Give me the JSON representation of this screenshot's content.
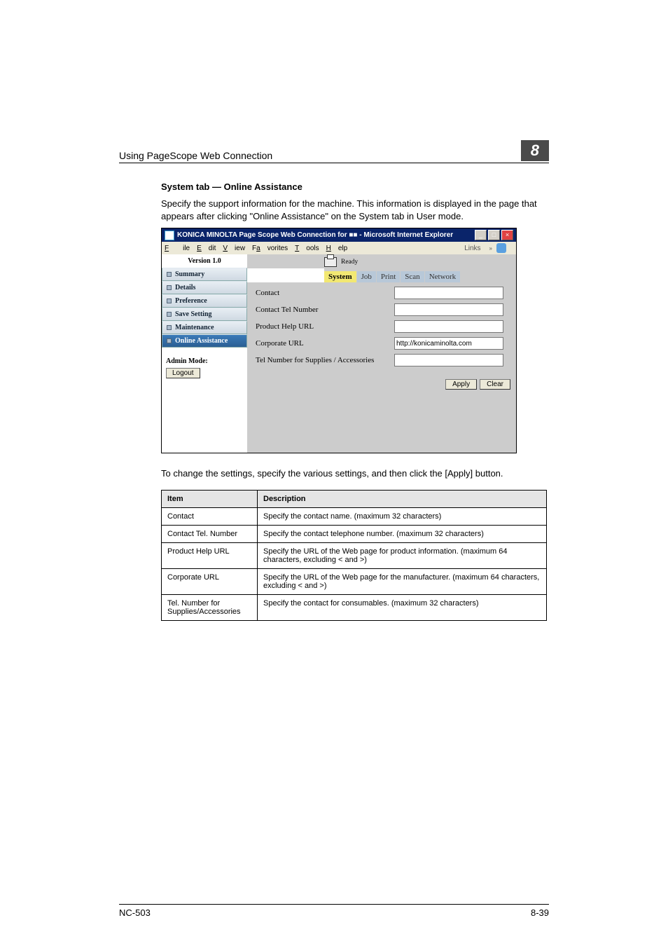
{
  "page": {
    "section_title": "Using PageScope Web Connection",
    "chapter_number": "8",
    "sub_heading": "System tab — Online Assistance",
    "intro_text": "Specify the support information for the machine. This information is displayed in the page that appears after clicking \"Online Assistance\" on the System tab in User mode.",
    "below_text": "To change the settings, specify the various settings, and then click the [Apply] button.",
    "footer_left": "NC-503",
    "footer_right": "8-39"
  },
  "screenshot": {
    "title_bar": "KONICA MINOLTA Page Scope Web Connection for ■■ - Microsoft Internet Explorer",
    "menu": {
      "file": "File",
      "edit": "Edit",
      "view": "View",
      "favorites": "Favorites",
      "tools": "Tools",
      "help": "Help",
      "links": "Links"
    },
    "status_text": "Ready",
    "version": "Version 1.0",
    "tabs": {
      "system": "System",
      "job": "Job",
      "print": "Print",
      "scan": "Scan",
      "network": "Network"
    },
    "sidebar": {
      "items": [
        {
          "label": "Summary"
        },
        {
          "label": "Details"
        },
        {
          "label": "Preference"
        },
        {
          "label": "Save Setting"
        },
        {
          "label": "Maintenance"
        },
        {
          "label": "Online Assistance"
        }
      ],
      "admin_mode_label": "Admin Mode:",
      "logout_label": "Logout"
    },
    "form": {
      "contact_label": "Contact",
      "contact_value": "",
      "contact_tel_label": "Contact Tel Number",
      "contact_tel_value": "",
      "product_help_label": "Product Help URL",
      "product_help_value": "",
      "corporate_url_label": "Corporate URL",
      "corporate_url_value": "http://konicaminolta.com",
      "supplies_label": "Tel Number for Supplies / Accessories",
      "supplies_value": "",
      "apply": "Apply",
      "clear": "Clear"
    }
  },
  "table": {
    "header_item": "Item",
    "header_desc": "Description",
    "rows": [
      {
        "item": "Contact",
        "desc": "Specify the contact name. (maximum 32 characters)"
      },
      {
        "item": "Contact Tel. Number",
        "desc": "Specify the contact telephone number. (maximum 32 characters)"
      },
      {
        "item": "Product Help URL",
        "desc": "Specify the URL of the Web page for product information. (maximum 64 characters, excluding < and >)"
      },
      {
        "item": "Corporate URL",
        "desc": "Specify the URL of the Web page for the manufacturer. (maximum 64 characters, excluding < and >)"
      },
      {
        "item": "Tel. Number for Supplies/Accessories",
        "desc": "Specify the contact for consumables. (maximum 32 characters)"
      }
    ]
  }
}
